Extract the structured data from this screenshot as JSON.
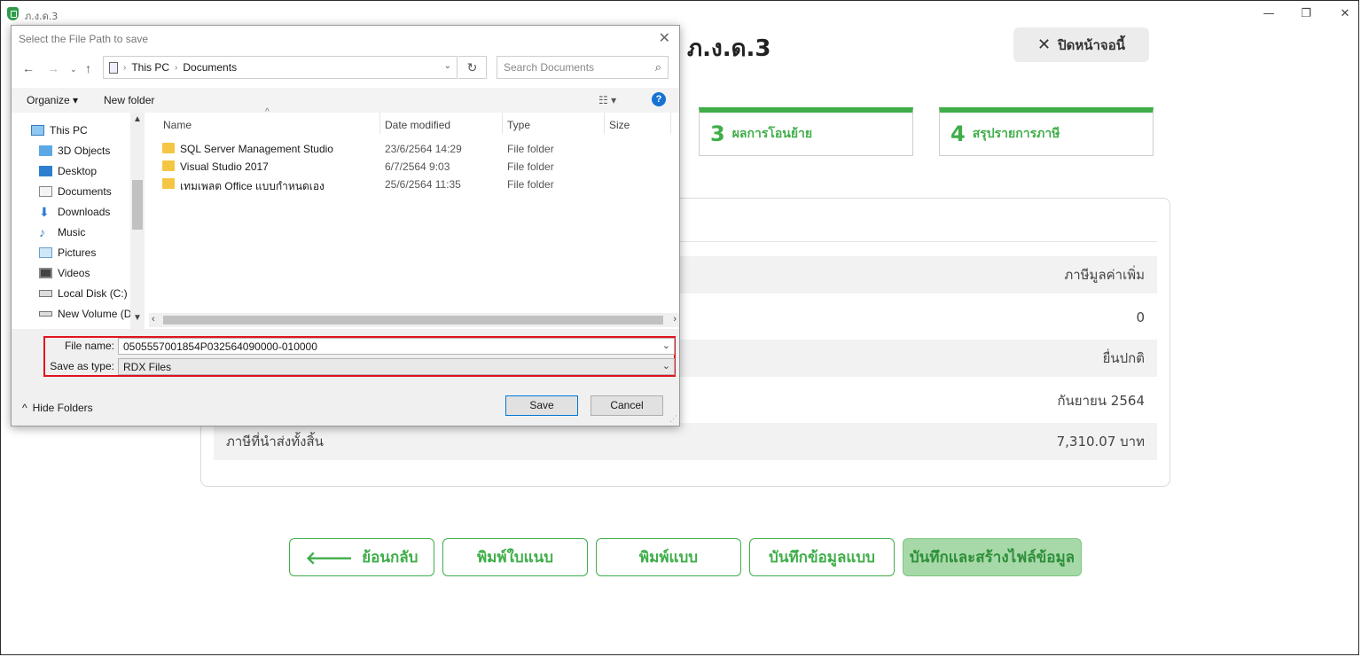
{
  "app": {
    "window_title": "ภ.ง.ด.3",
    "page_title": "ภ.ง.ด.3",
    "close_page_label": "ปิดหน้าจอนี้",
    "window_controls": {
      "minimize": "—",
      "restore": "❐",
      "close": "✕"
    }
  },
  "steps": [
    {
      "number": "3",
      "label": "ผลการโอนย้าย"
    },
    {
      "number": "4",
      "label": "สรุปรายการภาษี"
    }
  ],
  "summary": {
    "rows": [
      {
        "label": "",
        "value": "ภาษีมูลค่าเพิ่ม"
      },
      {
        "label": "",
        "value": "0"
      },
      {
        "label": "",
        "value": "ยื่นปกติ"
      },
      {
        "label": "",
        "value": "กันยายน 2564"
      },
      {
        "label": "ภาษีที่นำส่งทั้งสิ้น",
        "value": "7,310.07 บาท"
      }
    ]
  },
  "buttons": {
    "back": "ย้อนกลับ",
    "print_form": "พิมพ์ใบแนบ",
    "print": "พิมพ์แบบ",
    "save_form": "บันทึกข้อมูลแบบ",
    "save_and_create": "บันทึกและสร้างไฟล์ข้อมูล"
  },
  "dialog": {
    "title": "Select the File Path to save",
    "breadcrumb": [
      "This PC",
      "Documents"
    ],
    "search_placeholder": "Search Documents",
    "toolbar": {
      "organize": "Organize ▾",
      "new_folder": "New folder"
    },
    "columns": {
      "name": "Name",
      "date": "Date modified",
      "type": "Type",
      "size": "Size"
    },
    "nav_items": [
      {
        "label": "This PC",
        "icon": "pc-icon"
      },
      {
        "label": "3D Objects",
        "icon": "cube-icon"
      },
      {
        "label": "Desktop",
        "icon": "desktop-icon"
      },
      {
        "label": "Documents",
        "icon": "documents-icon"
      },
      {
        "label": "Downloads",
        "icon": "download-icon"
      },
      {
        "label": "Music",
        "icon": "music-icon"
      },
      {
        "label": "Pictures",
        "icon": "pictures-icon"
      },
      {
        "label": "Videos",
        "icon": "videos-icon"
      },
      {
        "label": "Local Disk (C:)",
        "icon": "disk-icon"
      },
      {
        "label": "New Volume (D:",
        "icon": "drive-icon"
      }
    ],
    "files": [
      {
        "name": "SQL Server Management Studio",
        "date": "23/6/2564 14:29",
        "type": "File folder"
      },
      {
        "name": "Visual Studio 2017",
        "date": "6/7/2564 9:03",
        "type": "File folder"
      },
      {
        "name": "เทมเพลต Office แบบกำหนดเอง",
        "date": "25/6/2564 11:35",
        "type": "File folder"
      }
    ],
    "file_name_label": "File name:",
    "file_name_value": "0505557001854P032564090000-010000",
    "save_type_label": "Save as type:",
    "save_type_value": "RDX Files",
    "hide_folders": "Hide Folders",
    "save": "Save",
    "cancel": "Cancel"
  },
  "colors": {
    "accent": "#3fae49",
    "highlight": "#e0141e",
    "help": "#1672d4"
  }
}
